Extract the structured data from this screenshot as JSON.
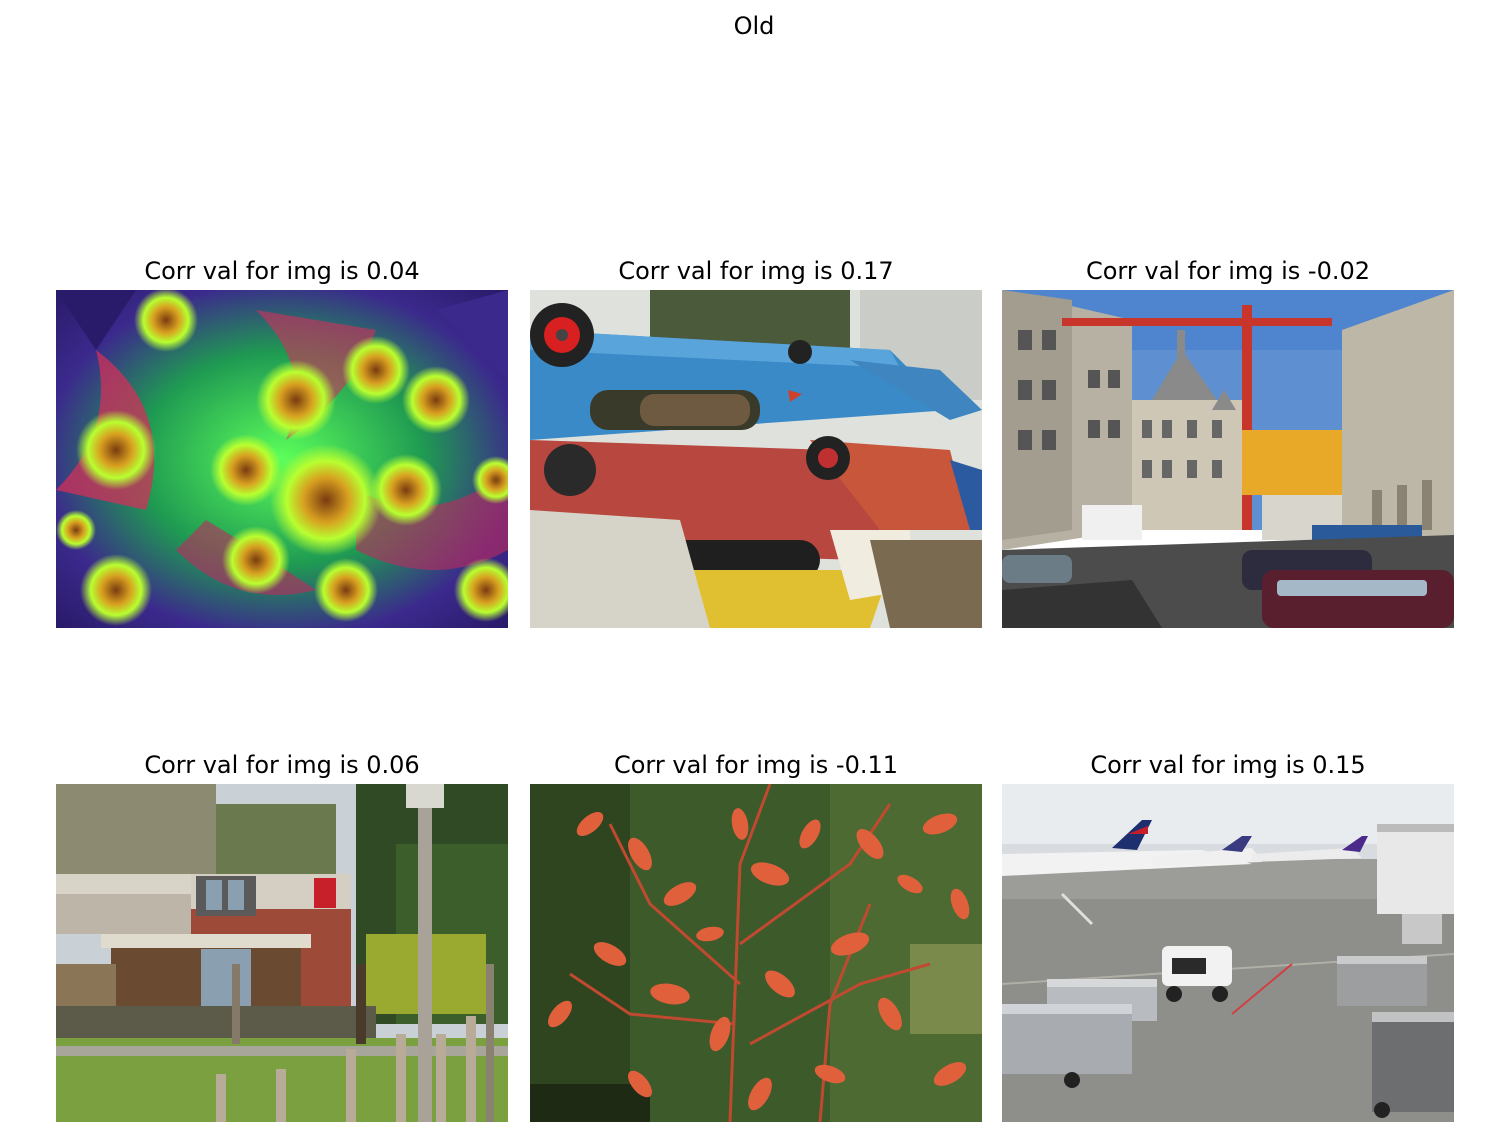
{
  "figure": {
    "title": "Old"
  },
  "panels": [
    {
      "title": "Corr val for img is 0.04",
      "image": "fractal-flowers-photo"
    },
    {
      "title": "Corr val for img is 0.17",
      "image": "stacked-boats-photo"
    },
    {
      "title": "Corr val for img is -0.02",
      "image": "city-street-crane-photo"
    },
    {
      "title": "Corr val for img is 0.06",
      "image": "house-fence-photo"
    },
    {
      "title": "Corr val for img is -0.11",
      "image": "red-leaves-pine-photo"
    },
    {
      "title": "Corr val for img is 0.15",
      "image": "airport-tarmac-photo"
    }
  ]
}
